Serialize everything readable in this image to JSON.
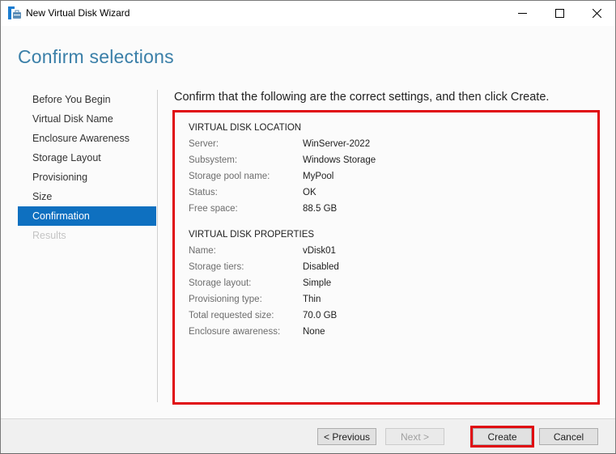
{
  "window": {
    "title": "New Virtual Disk Wizard",
    "app_icon": "server-manager-icon",
    "controls": {
      "minimize": "minimize-icon",
      "maximize": "maximize-icon",
      "close": "close-icon"
    }
  },
  "page": {
    "title": "Confirm selections",
    "intro": "Confirm that the following are the correct settings, and then click Create."
  },
  "nav": {
    "items": [
      {
        "label": "Before You Begin",
        "state": "normal"
      },
      {
        "label": "Virtual Disk Name",
        "state": "normal"
      },
      {
        "label": "Enclosure Awareness",
        "state": "normal"
      },
      {
        "label": "Storage Layout",
        "state": "normal"
      },
      {
        "label": "Provisioning",
        "state": "normal"
      },
      {
        "label": "Size",
        "state": "normal"
      },
      {
        "label": "Confirmation",
        "state": "active"
      },
      {
        "label": "Results",
        "state": "disabled"
      }
    ]
  },
  "summary": {
    "location": {
      "title": "VIRTUAL DISK LOCATION",
      "rows": [
        {
          "label": "Server:",
          "value": "WinServer-2022"
        },
        {
          "label": "Subsystem:",
          "value": "Windows Storage"
        },
        {
          "label": "Storage pool name:",
          "value": "MyPool"
        },
        {
          "label": "Status:",
          "value": "OK"
        },
        {
          "label": "Free space:",
          "value": "88.5 GB"
        }
      ]
    },
    "properties": {
      "title": "VIRTUAL DISK PROPERTIES",
      "rows": [
        {
          "label": "Name:",
          "value": "vDisk01"
        },
        {
          "label": "Storage tiers:",
          "value": "Disabled"
        },
        {
          "label": "Storage layout:",
          "value": "Simple"
        },
        {
          "label": "Provisioning type:",
          "value": "Thin"
        },
        {
          "label": "Total requested size:",
          "value": "70.0 GB"
        },
        {
          "label": "Enclosure awareness:",
          "value": "None"
        }
      ]
    }
  },
  "footer": {
    "previous_label": "< Previous",
    "next_label": "Next >",
    "create_label": "Create",
    "cancel_label": "Cancel"
  },
  "colors": {
    "accent": "#0e70c0",
    "title": "#3a7fa8",
    "highlight": "#e0080f"
  }
}
